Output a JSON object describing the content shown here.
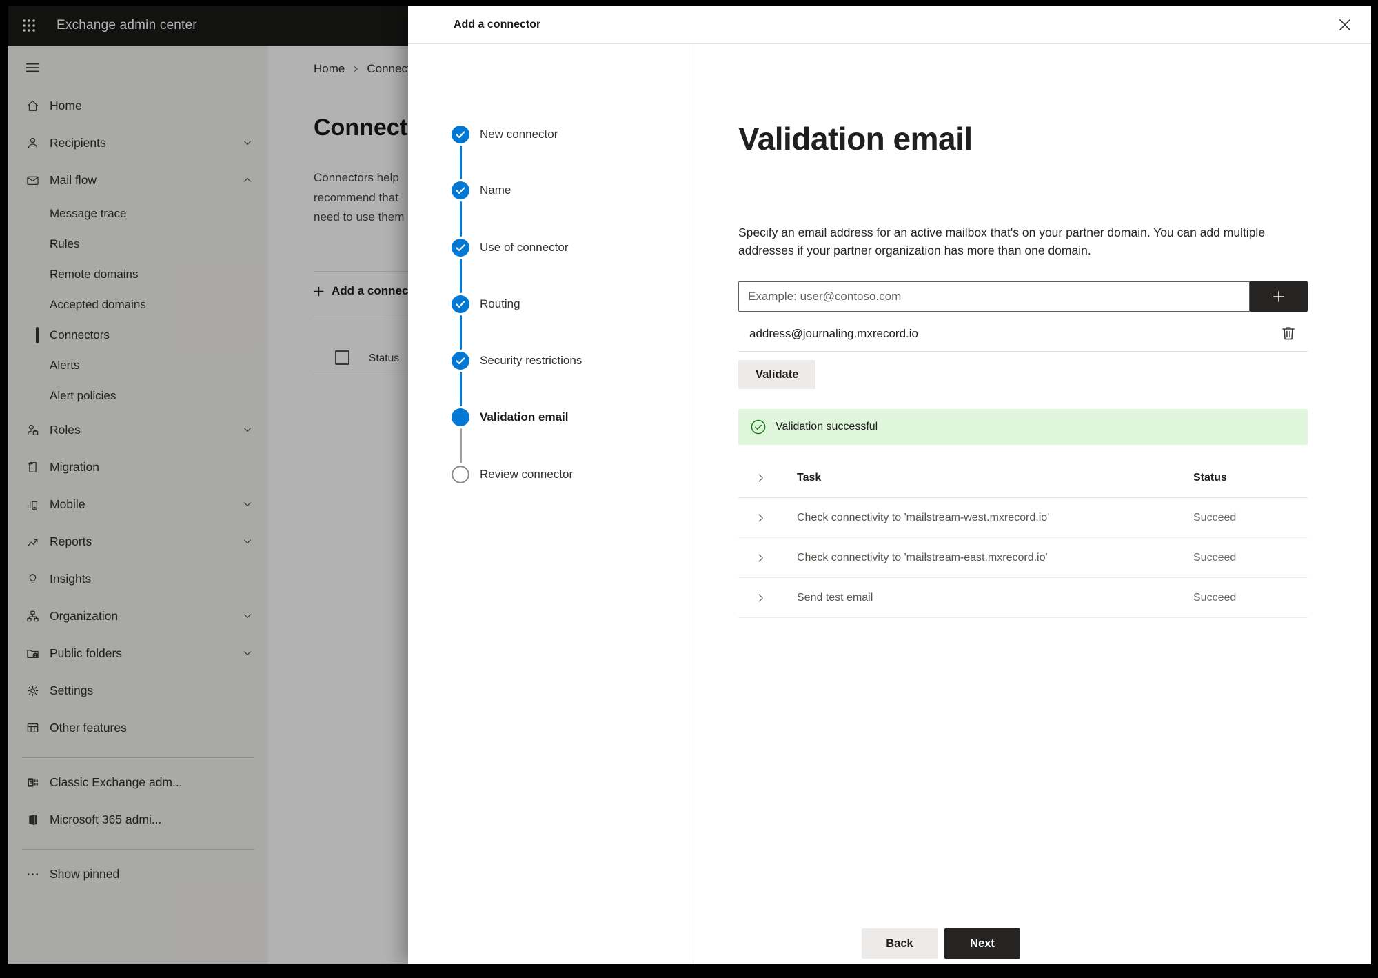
{
  "app": {
    "title": "Exchange admin center"
  },
  "colors": {
    "accent_blue": "#0078D4",
    "success_green": "#107C10",
    "success_banner_bg": "#DFF6DD",
    "dark_button": "#252423",
    "topbar_bg": "#1B1A19",
    "sidebar_bg": "#F3F2F1"
  },
  "sidebar": {
    "items": [
      {
        "label": "Home",
        "icon": "home-icon"
      },
      {
        "label": "Recipients",
        "icon": "person-icon",
        "chevron": "down"
      },
      {
        "label": "Mail flow",
        "icon": "mail-icon",
        "chevron": "up",
        "expanded": true
      },
      {
        "label": "Message trace",
        "sub": true
      },
      {
        "label": "Rules",
        "sub": true
      },
      {
        "label": "Remote domains",
        "sub": true
      },
      {
        "label": "Accepted domains",
        "sub": true
      },
      {
        "label": "Connectors",
        "sub": true,
        "selected": true
      },
      {
        "label": "Alerts",
        "sub": true
      },
      {
        "label": "Alert policies",
        "sub": true
      },
      {
        "label": "Roles",
        "icon": "roles-icon",
        "chevron": "down"
      },
      {
        "label": "Migration",
        "icon": "migration-icon"
      },
      {
        "label": "Mobile",
        "icon": "mobile-icon",
        "chevron": "down"
      },
      {
        "label": "Reports",
        "icon": "reports-icon",
        "chevron": "down"
      },
      {
        "label": "Insights",
        "icon": "insights-icon"
      },
      {
        "label": "Organization",
        "icon": "organization-icon",
        "chevron": "down"
      },
      {
        "label": "Public folders",
        "icon": "public-folders-icon",
        "chevron": "down"
      },
      {
        "label": "Settings",
        "icon": "settings-icon"
      },
      {
        "label": "Other features",
        "icon": "other-features-icon"
      },
      {
        "label": "Classic Exchange adm...",
        "icon": "classic-exchange-icon"
      },
      {
        "label": "Microsoft 365 admi...",
        "icon": "microsoft-365-icon"
      },
      {
        "label": "Show pinned",
        "icon": "ellipsis-icon"
      }
    ]
  },
  "background_page": {
    "breadcrumb": {
      "home": "Home",
      "current": "Connectors"
    },
    "heading": "Connectors",
    "paragraph_lines": [
      "Connectors help",
      "recommend that",
      "need to use them"
    ],
    "add_button_label": "Add a connector",
    "list_header": "Status"
  },
  "panel": {
    "title": "Add a connector",
    "steps": [
      {
        "label": "New connector",
        "state": "done"
      },
      {
        "label": "Name",
        "state": "done"
      },
      {
        "label": "Use of connector",
        "state": "done"
      },
      {
        "label": "Routing",
        "state": "done"
      },
      {
        "label": "Security restrictions",
        "state": "done"
      },
      {
        "label": "Validation email",
        "state": "current"
      },
      {
        "label": "Review connector",
        "state": "todo"
      }
    ],
    "content": {
      "heading": "Validation email",
      "description": "Specify an email address for an active mailbox that's on your partner domain. You can add multiple addresses if your partner organization has more than one domain.",
      "email_input": {
        "placeholder": "Example: user@contoso.com",
        "value": ""
      },
      "added_address": "address@journaling.mxrecord.io",
      "validate_button": "Validate",
      "success_message": "Validation successful",
      "results_table": {
        "columns": {
          "task": "Task",
          "status": "Status"
        },
        "rows": [
          {
            "task": "Check connectivity to 'mailstream-west.mxrecord.io'",
            "status": "Succeed"
          },
          {
            "task": "Check connectivity to 'mailstream-east.mxrecord.io'",
            "status": "Succeed"
          },
          {
            "task": "Send test email",
            "status": "Succeed"
          }
        ]
      }
    },
    "footer": {
      "back": "Back",
      "next": "Next"
    }
  }
}
